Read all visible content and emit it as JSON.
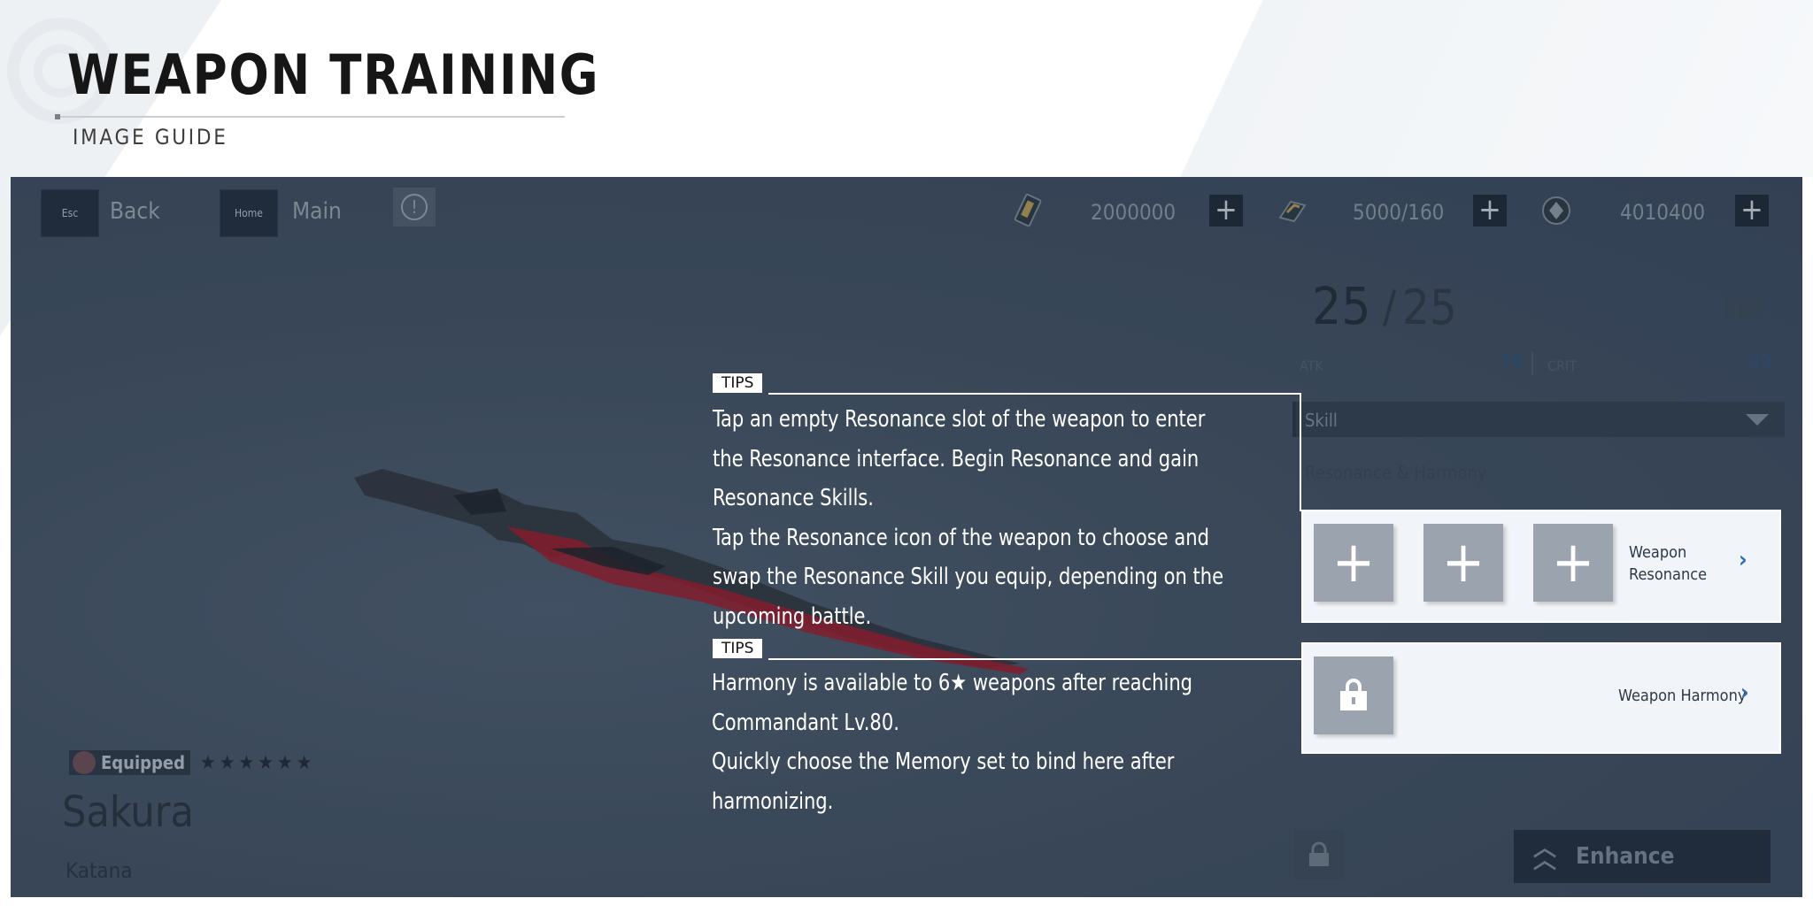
{
  "header": {
    "title": "WEAPON TRAINING",
    "subtitle": "IMAGE GUIDE"
  },
  "top_bar": {
    "esc_key": "Esc",
    "back_label": "Back",
    "home_key": "Home",
    "main_label": "Main",
    "resources": [
      {
        "icon": "currency-card-icon",
        "value": "2000000"
      },
      {
        "icon": "stamina-icon",
        "value": "5000/160"
      },
      {
        "icon": "crystal-icon",
        "value": "4010400"
      }
    ]
  },
  "weapon": {
    "status": "Equipped",
    "stars": "★★★★★★",
    "name": "Sakura",
    "type": "Katana"
  },
  "panel": {
    "level_current": "25",
    "level_max": "25",
    "atk_label": "ATK",
    "atk_value": "79",
    "crit_label": "CRIT",
    "crit_value": "49",
    "skill_dropdown": "Skill",
    "section_label": "Resonance & Harmony",
    "resonance_label": "Weapon Resonance",
    "harmony_label": "Weapon Harmony",
    "enhance_label": "Enhance"
  },
  "tips": [
    {
      "tag": "TIPS",
      "paragraphs": [
        "Tap an empty Resonance slot of the weapon to enter the Resonance interface. Begin Resonance and gain Resonance Skills.",
        "Tap the Resonance icon of the weapon to choose and swap the Resonance Skill you equip, depending on the upcoming battle."
      ]
    },
    {
      "tag": "TIPS",
      "paragraphs": [
        "Harmony is available to 6★ weapons after reaching Commandant Lv.80.",
        "Quickly choose the Memory set to bind here after harmonizing."
      ]
    }
  ],
  "colors": {
    "accent_blue": "#2b6bb0",
    "screen_bg": "#3f4e5f",
    "weapon_red": "#b0162a"
  }
}
